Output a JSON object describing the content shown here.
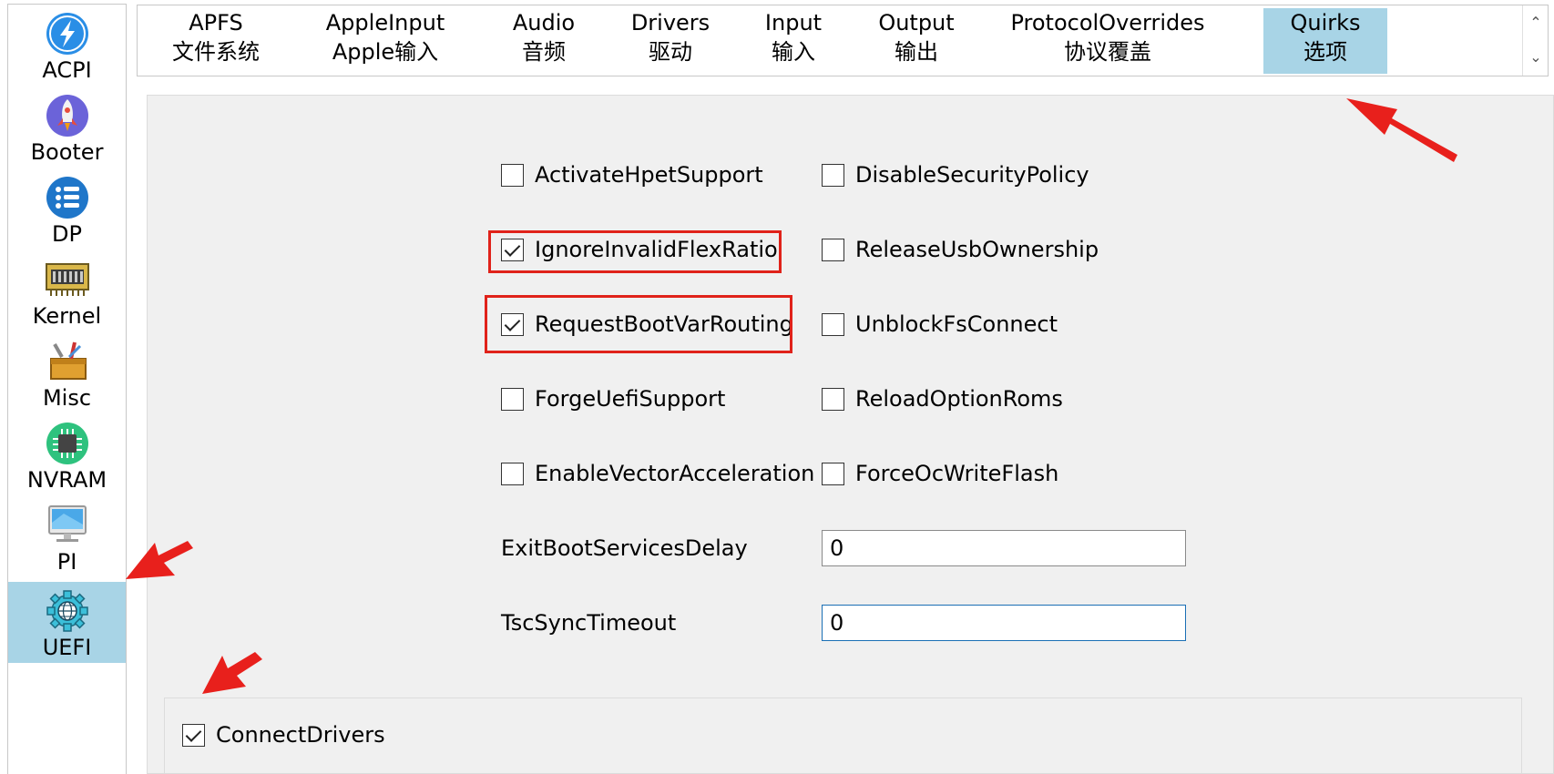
{
  "sidebar": {
    "items": [
      {
        "label": "ACPI",
        "icon": "acpi-lightning-icon",
        "selected": false
      },
      {
        "label": "Booter",
        "icon": "rocket-icon",
        "selected": false
      },
      {
        "label": "DP",
        "icon": "list-icon",
        "selected": false
      },
      {
        "label": "Kernel",
        "icon": "chip-board-icon",
        "selected": false
      },
      {
        "label": "Misc",
        "icon": "toolbox-icon",
        "selected": false
      },
      {
        "label": "NVRAM",
        "icon": "microchip-icon",
        "selected": false
      },
      {
        "label": "PI",
        "icon": "monitor-icon",
        "selected": false
      },
      {
        "label": "UEFI",
        "icon": "globe-gear-icon",
        "selected": true
      }
    ]
  },
  "tabs": [
    {
      "en": "APFS",
      "zh": "文件系统",
      "selected": false
    },
    {
      "en": "AppleInput",
      "zh": "Apple输入",
      "selected": false
    },
    {
      "en": "Audio",
      "zh": "音频",
      "selected": false
    },
    {
      "en": "Drivers",
      "zh": "驱动",
      "selected": false
    },
    {
      "en": "Input",
      "zh": "输入",
      "selected": false
    },
    {
      "en": "Output",
      "zh": "输出",
      "selected": false
    },
    {
      "en": "ProtocolOverrides",
      "zh": "协议覆盖",
      "selected": false
    },
    {
      "en": "Quirks",
      "zh": "选项",
      "selected": true
    }
  ],
  "quirks": {
    "left": [
      {
        "label": "ActivateHpetSupport",
        "checked": false
      },
      {
        "label": "IgnoreInvalidFlexRatio",
        "checked": true
      },
      {
        "label": "RequestBootVarRouting",
        "checked": true
      },
      {
        "label": "ForgeUefiSupport",
        "checked": false
      },
      {
        "label": "EnableVectorAcceleration",
        "checked": false
      }
    ],
    "right": [
      {
        "label": "DisableSecurityPolicy",
        "checked": false
      },
      {
        "label": "ReleaseUsbOwnership",
        "checked": false
      },
      {
        "label": "UnblockFsConnect",
        "checked": false
      },
      {
        "label": "ReloadOptionRoms",
        "checked": false
      },
      {
        "label": "ForceOcWriteFlash",
        "checked": false
      }
    ],
    "fields": [
      {
        "label": "ExitBootServicesDelay",
        "value": "0"
      },
      {
        "label": "TscSyncTimeout",
        "value": "0"
      }
    ]
  },
  "connect_drivers": {
    "label": "ConnectDrivers",
    "checked": true
  },
  "colors": {
    "selection": "#a8d4e6",
    "highlight_red": "#e0221a",
    "panel_bg": "#f0f0f0"
  }
}
